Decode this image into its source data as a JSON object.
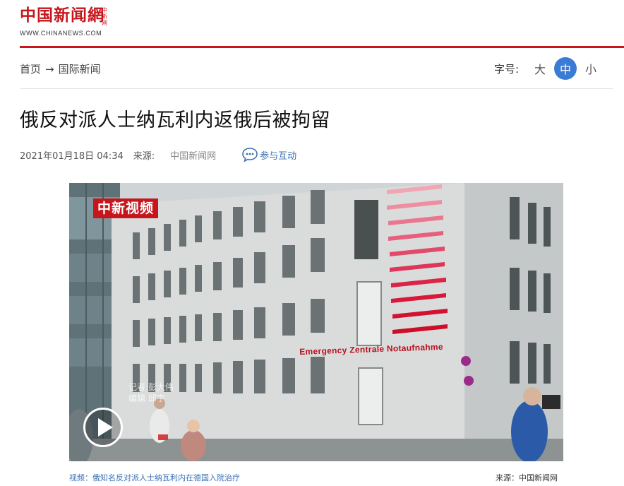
{
  "logo": {
    "cn": "中国新闻網",
    "vertical": "中新网",
    "en": "WWW.CHINANEWS.COM"
  },
  "breadcrumb": {
    "home": "首页",
    "arrow": "→",
    "section": "国际新闻"
  },
  "font_size": {
    "label": "字号:",
    "large": "大",
    "medium": "中",
    "small": "小",
    "selected": "中"
  },
  "article": {
    "title": "俄反对派人士纳瓦利内返俄后被拘留",
    "datetime": "2021年01月18日 04:34",
    "source_label": "来源:",
    "source": "中国新闻网",
    "interact_label": "参与互动"
  },
  "video": {
    "watermark": "中新视频",
    "reporter_line1": "记者 彭大伟",
    "reporter_line2": "编辑 邱宇",
    "sign_text": "Emergency  Zentrale  Notaufnahme",
    "caption": "视频：俄知名反对派人士纳瓦利内在德国入院治疗",
    "caption_source": "来源：中国新闻网"
  },
  "colors": {
    "brand_red": "#c6161c",
    "link_blue": "#3a6fb5",
    "active_blue": "#3a7bd5"
  }
}
